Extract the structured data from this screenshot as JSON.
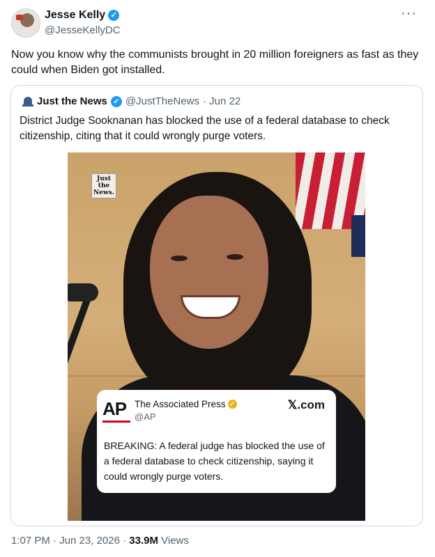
{
  "author": {
    "name": "Jesse Kelly",
    "handle": "@JesseKellyDC"
  },
  "tweet_text": "Now you know why the communists brought in 20 million foreigners as fast as they could when Biden got installed.",
  "more_icon": "···",
  "quote": {
    "name": "Just the News",
    "handle": "@JustTheNews",
    "date": "· Jun 22",
    "text": "District Judge Sooknanan has blocked the use of a federal database to check citizenship, citing that it could wrongly purge voters.",
    "watermark": "Just the News.",
    "ap_card": {
      "logo": "AP",
      "name": "The Associated Press",
      "handle": "@AP",
      "site": "𝕏.com",
      "text": "BREAKING: A federal judge has blocked the use of a federal database to check citizenship, saying it could wrongly purge voters."
    }
  },
  "footer": {
    "time": "1:07 PM · Jun 23, 2026 · ",
    "views_count": "33.9M",
    "views_label": " Views"
  },
  "colors": {
    "verified_blue": "#1d9bf0",
    "verified_gold": "#e2b719",
    "ap_red": "#d0021b"
  }
}
